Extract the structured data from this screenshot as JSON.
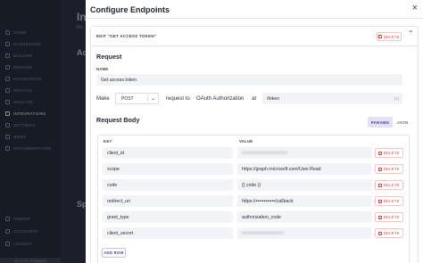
{
  "sidebar": {
    "items": [
      {
        "label": "HOME",
        "icon": "home-icon"
      },
      {
        "label": "DASHBOARD",
        "icon": "dashboard-icon"
      },
      {
        "label": "BUILDER",
        "icon": "builder-icon"
      },
      {
        "label": "ENGAGE",
        "icon": "engage-icon"
      },
      {
        "label": "KNOWLEDGE",
        "icon": "knowledge-icon"
      },
      {
        "label": "SERVICE",
        "icon": "service-icon"
      },
      {
        "label": "ANALYZE",
        "icon": "analyze-icon"
      },
      {
        "label": "INTEGRATIONS",
        "icon": "integrations-icon"
      },
      {
        "label": "SETTINGS",
        "icon": "gear-icon"
      },
      {
        "label": "DEMO",
        "icon": "demo-icon"
      },
      {
        "label": "DOCUMENTATION",
        "icon": "document-icon"
      }
    ],
    "bottom_items": [
      {
        "label": "OWNER",
        "icon": "user-icon"
      },
      {
        "label": "ACCOUNTS",
        "icon": "accounts-icon"
      },
      {
        "label": "LOGOUT",
        "icon": "logout-icon"
      }
    ],
    "footer": "ACTIVE DOMAIN"
  },
  "background": {
    "title": "In",
    "subtitle": "Ma",
    "heading1": "Ac",
    "heading2": "Sp"
  },
  "modal": {
    "title": "Configure Endpoints",
    "edit_label": "EDIT \"GET ACCESS TOKEN\"",
    "delete_label": "DELETE",
    "request_section": "Request",
    "name_label": "NAME",
    "name_value": "Get access token",
    "make_label": "Make",
    "method": "POST",
    "request_to_label": "request to",
    "target": "OAuth Authorization",
    "at_label": "at",
    "path": "/token",
    "path_suffix": "{x}",
    "body_section": "Request Body",
    "params_tab": "PARAMS",
    "json_tab": "JSON",
    "key_header": "KEY",
    "value_header": "VALUE",
    "rows": [
      {
        "key": "client_id",
        "value": "••••••••••••••••••••••••••••",
        "blurred": true
      },
      {
        "key": "scope",
        "value": "https://graph.microsoft.com/User.Read",
        "blurred": false
      },
      {
        "key": "code",
        "value": "{{ code }}",
        "blurred": false
      },
      {
        "key": "redirect_uri",
        "value": "https://••••••••••••/callback",
        "blurred": false
      },
      {
        "key": "grant_type",
        "value": "authorization_code",
        "blurred": false
      },
      {
        "key": "client_secret",
        "value": "••••••••••••••••••••••••••",
        "blurred": true
      }
    ],
    "add_row_label": "ADD ROW"
  },
  "colors": {
    "accent": "#4c3f8f",
    "danger": "#d34a4a",
    "sidebar_bg": "#222838"
  }
}
